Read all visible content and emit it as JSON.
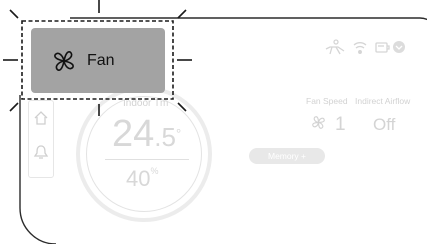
{
  "popup": {
    "label": "Fan",
    "icon": "fan-icon"
  },
  "status_icons": [
    "person-icon",
    "wifi-icon",
    "battery-icon",
    "shield-icon"
  ],
  "left_nav": [
    {
      "icon": "home-icon"
    },
    {
      "icon": "bell-icon"
    }
  ],
  "temperature": {
    "indoor_label": "Indoor Tm",
    "current_int": "24",
    "current_dec": ".5",
    "degree_symbol": "°",
    "humidity_value": "40",
    "humidity_unit": "%"
  },
  "fan_speed": {
    "label": "Fan Speed",
    "value": "1",
    "icon": "fan-icon"
  },
  "indirect_airflow": {
    "label": "Indirect Airflow",
    "value": "Off"
  },
  "memory_button": {
    "label": "Memory +"
  }
}
